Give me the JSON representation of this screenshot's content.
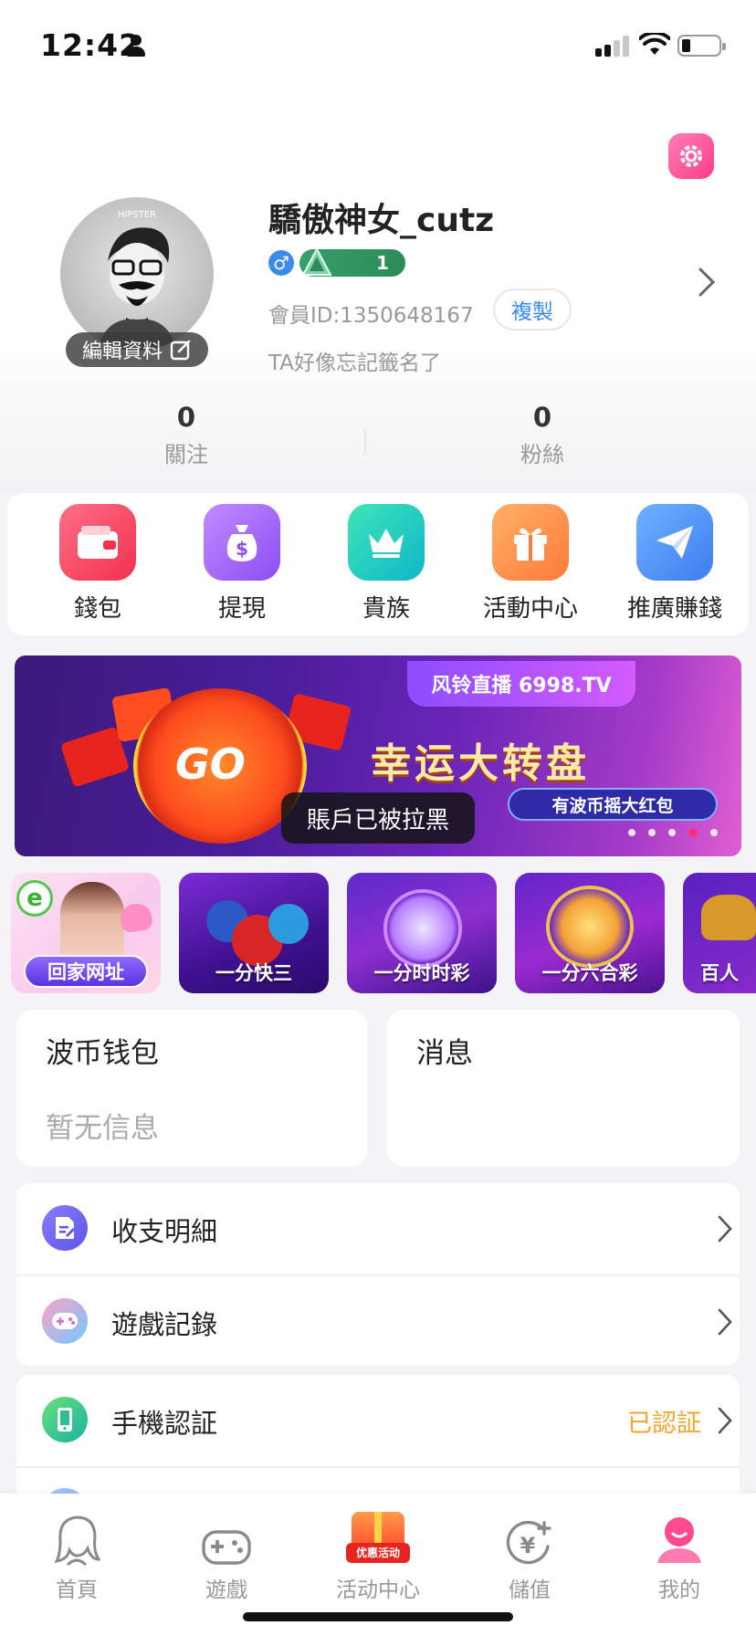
{
  "status_bar": {
    "time": "12:42"
  },
  "profile": {
    "username": "驕傲神女_cutz",
    "gender_symbol": "♂",
    "level": "1",
    "member_id": "會員ID:1350648167",
    "copy_label": "複製",
    "signature": "TA好像忘記籤名了",
    "edit_label": "編輯資料",
    "avatar_text": "HIPSTER"
  },
  "stats": [
    {
      "value": "0",
      "label": "關注"
    },
    {
      "value": "0",
      "label": "粉絲"
    }
  ],
  "quick_actions": [
    {
      "label": "錢包",
      "icon": "wallet-icon"
    },
    {
      "label": "提現",
      "icon": "money-bag-icon"
    },
    {
      "label": "貴族",
      "icon": "crown-icon"
    },
    {
      "label": "活動中心",
      "icon": "gift-icon"
    },
    {
      "label": "推廣賺錢",
      "icon": "paper-plane-icon"
    }
  ],
  "banner": {
    "brand": "风铃直播 6998.TV",
    "title": "幸运大转盘",
    "subtitle": "有波币摇大红包",
    "go_label": "GO",
    "toast": "賬戶已被拉黑",
    "slide_count": 5,
    "active_slide": 4
  },
  "game_tiles": [
    {
      "label": "回家网址"
    },
    {
      "label": "一分快三"
    },
    {
      "label": "一分时时彩"
    },
    {
      "label": "一分六合彩"
    },
    {
      "label": "百人"
    }
  ],
  "wallet_card": {
    "title": "波币钱包",
    "subtitle": "暂无信息"
  },
  "message_card": {
    "title": "消息"
  },
  "list_group_1": [
    {
      "label": "收支明細",
      "icon": "document-icon"
    },
    {
      "label": "遊戲記錄",
      "icon": "gamepad-icon"
    }
  ],
  "list_group_2": [
    {
      "label": "手機認証",
      "value": "已認証",
      "icon": "phone-icon"
    }
  ],
  "tabs": [
    {
      "label": "首頁",
      "icon": "girl-silhouette-icon"
    },
    {
      "label": "遊戲",
      "icon": "gamepad-icon"
    },
    {
      "label": "活动中心",
      "icon": "promo-gift-icon",
      "badge": "优惠活动"
    },
    {
      "label": "儲值",
      "icon": "yen-coin-icon"
    },
    {
      "label": "我的",
      "icon": "user-profile-icon"
    }
  ],
  "colors": {
    "accent_pink": "#ff3d8a",
    "link_blue": "#3a8bf0",
    "verified_orange": "#f3a52c",
    "level_green": "#35a06a"
  }
}
